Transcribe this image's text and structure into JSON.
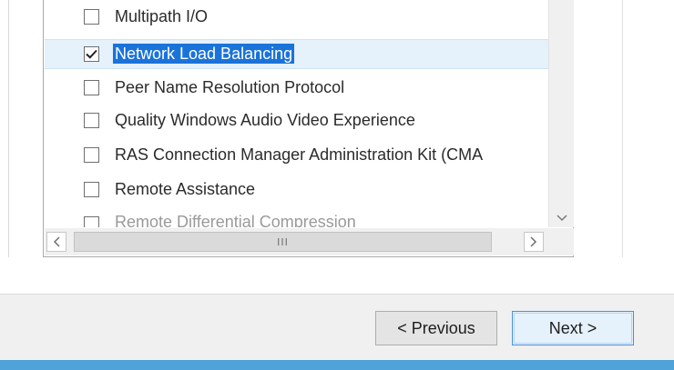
{
  "features_list": {
    "items": [
      {
        "label": "Multipath I/O",
        "checked": false,
        "selected": false
      },
      {
        "label": "Network Load Balancing",
        "checked": true,
        "selected": true
      },
      {
        "label": "Peer Name Resolution Protocol",
        "checked": false,
        "selected": false
      },
      {
        "label": "Quality Windows Audio Video Experience",
        "checked": false,
        "selected": false
      },
      {
        "label": "RAS Connection Manager Administration Kit (CMA",
        "checked": false,
        "selected": false
      },
      {
        "label": "Remote Assistance",
        "checked": false,
        "selected": false
      }
    ],
    "partial_item_label": "Remote Differential Compression"
  },
  "scrollbars": {
    "vertical_down_icon": "chevron-down-icon",
    "horizontal_left_icon": "chevron-left-icon",
    "horizontal_right_icon": "chevron-right-icon",
    "thumb_grip": "III"
  },
  "footer": {
    "previous_label": "< Previous",
    "next_label": "Next >"
  },
  "colors": {
    "selection_highlight": "#1a73d9",
    "selected_row_bg": "#e5f1fb",
    "accent_strip": "#4fa3d8",
    "footer_bg": "#f0f0f0"
  }
}
